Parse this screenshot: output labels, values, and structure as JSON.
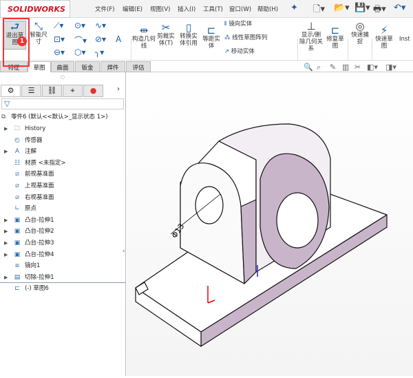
{
  "app": {
    "logo": "SOLIDWORKS"
  },
  "menu": [
    "文件(F)",
    "编辑(E)",
    "视图(V)",
    "插入(I)",
    "工具(T)",
    "窗口(W)",
    "帮助(H)"
  ],
  "ribbon": {
    "exit_sketch": "退出草图",
    "smart_dim": "智能尺寸",
    "construct": "构造几何线",
    "trim": "剪裁实体(T)",
    "convert": "转换实体引用",
    "offset": "等距实体",
    "mirror": "镜向实体",
    "linear_pattern": "线性草图阵列",
    "move": "移动实体",
    "show_relations": "显示/删除几何关系",
    "repair": "修复草图",
    "quick_snap": "快速捕捉",
    "rapid_sketch": "快速草图",
    "instant": "Inst"
  },
  "badge": "1",
  "tabs": [
    "特征",
    "草图",
    "曲面",
    "钣金",
    "焊件",
    "评估"
  ],
  "tree": {
    "root": "零件6 (默认<<默认>_显示状态 1>)",
    "items": [
      {
        "label": "History",
        "icon": "history-folder-icon",
        "arrow": true
      },
      {
        "label": "传感器",
        "icon": "sensor-icon",
        "arrow": false
      },
      {
        "label": "注解",
        "icon": "annotation-icon",
        "arrow": true
      },
      {
        "label": "材质 <未指定>",
        "icon": "material-icon",
        "arrow": false
      },
      {
        "label": "前视基准面",
        "icon": "plane-icon",
        "arrow": false
      },
      {
        "label": "上视基准面",
        "icon": "plane-icon",
        "arrow": false
      },
      {
        "label": "右视基准面",
        "icon": "plane-icon",
        "arrow": false
      },
      {
        "label": "原点",
        "icon": "origin-icon",
        "arrow": false
      },
      {
        "label": "凸台-拉伸1",
        "icon": "extrude-icon",
        "arrow": true
      },
      {
        "label": "凸台-拉伸2",
        "icon": "extrude-icon",
        "arrow": true
      },
      {
        "label": "凸台-拉伸3",
        "icon": "extrude-icon",
        "arrow": true
      },
      {
        "label": "凸台-拉伸4",
        "icon": "extrude-icon",
        "arrow": true
      },
      {
        "label": "镜向1",
        "icon": "mirror-icon",
        "arrow": false
      },
      {
        "label": "切除-拉伸1",
        "icon": "cut-icon",
        "arrow": true
      },
      {
        "label": "(-) 草图6",
        "icon": "sketch-icon",
        "arrow": false
      }
    ]
  },
  "viewport": {
    "dimension": "Φ13"
  }
}
